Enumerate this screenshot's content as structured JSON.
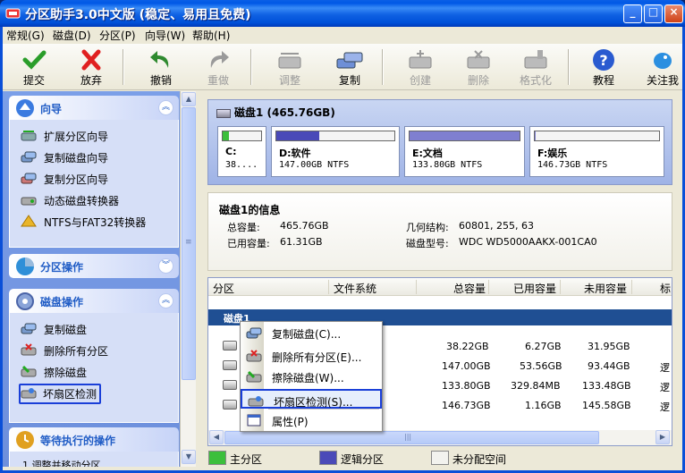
{
  "window": {
    "title": "分区助手3.0中文版 (稳定、易用且免费)",
    "minimize": "_",
    "maximize": "□",
    "close": "×"
  },
  "menu": [
    "常规(G)",
    "磁盘(D)",
    "分区(P)",
    "向导(W)",
    "帮助(H)"
  ],
  "toolbar": [
    {
      "label": "提交",
      "icon": "check-icon",
      "enabled": true
    },
    {
      "label": "放弃",
      "icon": "cross-icon",
      "enabled": true
    },
    {
      "label": "撤销",
      "icon": "undo-icon",
      "enabled": true
    },
    {
      "label": "重做",
      "icon": "redo-icon",
      "enabled": false
    },
    {
      "label": "调整",
      "icon": "resize-disk-icon",
      "enabled": false
    },
    {
      "label": "复制",
      "icon": "copy-disk-icon",
      "enabled": true
    },
    {
      "label": "创建",
      "icon": "create-partition-icon",
      "enabled": false
    },
    {
      "label": "删除",
      "icon": "delete-partition-icon",
      "enabled": false
    },
    {
      "label": "格式化",
      "icon": "format-icon",
      "enabled": false
    },
    {
      "label": "教程",
      "icon": "help-icon",
      "enabled": true
    },
    {
      "label": "关注我",
      "icon": "bird-icon",
      "enabled": true
    }
  ],
  "sidebar": {
    "wizard": {
      "title": "向导",
      "chevron": "︽",
      "items": [
        "扩展分区向导",
        "复制磁盘向导",
        "复制分区向导",
        "动态磁盘转换器",
        "NTFS与FAT32转换器"
      ]
    },
    "partition_ops": {
      "title": "分区操作",
      "chevron": "︾"
    },
    "disk_ops": {
      "title": "磁盘操作",
      "chevron": "︽",
      "items": [
        "复制磁盘",
        "删除所有分区",
        "擦除磁盘",
        "坏扇区检测"
      ],
      "selected": "坏扇区检测"
    },
    "pending": {
      "title": "等待执行的操作",
      "partial_item": "1 调整并移动分区"
    }
  },
  "scrollbar": {
    "up": "▲",
    "down": "▼",
    "grip": "≡",
    "left": "◀",
    "right": "▶",
    "hgrip": "|||"
  },
  "diskmap": {
    "title": "磁盘1 (465.76GB)",
    "partitions": [
      {
        "name": "C:",
        "info": "38....",
        "used_fraction": 0.16,
        "color": "#3cbf3c"
      },
      {
        "name": "D:软件",
        "info": "147.00GB NTFS",
        "used_fraction": 0.36,
        "color": "#4a4ab8"
      },
      {
        "name": "E:文档",
        "info": "133.80GB NTFS",
        "used_fraction": 1.0,
        "color": "#7f7fd0"
      },
      {
        "name": "F:娱乐",
        "info": "146.73GB NTFS",
        "used_fraction": 0.01,
        "color": "#7f7fd0"
      }
    ]
  },
  "diskinfo": {
    "title": "磁盘1的信息",
    "total_label": "总容量:",
    "total_value": "465.76GB",
    "used_label": "已用容量:",
    "used_value": "61.31GB",
    "geometry_label": "几何结构:",
    "geometry_value": "60801, 255, 63",
    "model_label": "磁盘型号:",
    "model_value": "WDC WD5000AAKX-001CA0"
  },
  "table": {
    "headers": [
      "分区",
      "文件系统",
      "总容量",
      "已用容量",
      "未用容量",
      "标"
    ],
    "disk_label": "磁盘1",
    "rows": [
      {
        "total": "38.22GB",
        "used": "6.27GB",
        "free": "31.95GB",
        "flag": ""
      },
      {
        "total": "147.00GB",
        "used": "53.56GB",
        "free": "93.44GB",
        "flag": "逻"
      },
      {
        "total": "133.80GB",
        "used": "329.84MB",
        "free": "133.48GB",
        "flag": "逻"
      },
      {
        "total": "146.73GB",
        "used": "1.16GB",
        "free": "145.58GB",
        "flag": "逻"
      }
    ]
  },
  "legend": [
    {
      "label": "主分区",
      "color": "#3cbf3c"
    },
    {
      "label": "逻辑分区",
      "color": "#4a4ab8"
    },
    {
      "label": "未分配空间",
      "color": "#f2f2ee"
    }
  ],
  "context_menu": {
    "items": [
      "复制磁盘(C)...",
      "删除所有分区(E)...",
      "擦除磁盘(W)...",
      "坏扇区检测(S)...",
      "属性(P)"
    ],
    "highlighted": "坏扇区检测(S)..."
  }
}
